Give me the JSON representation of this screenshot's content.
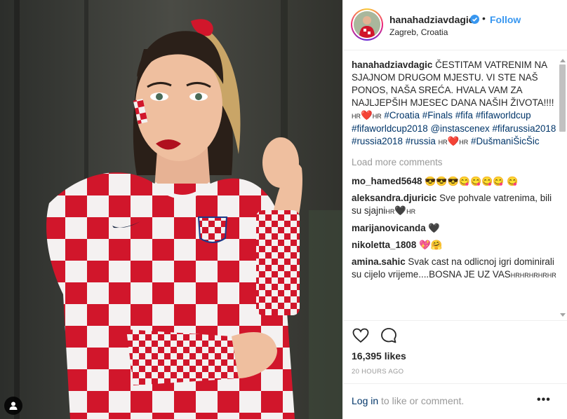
{
  "post": {
    "username": "hanahadziavdagic",
    "location": "Zagreb, Croatia",
    "follow_label": "Follow",
    "dot": "•"
  },
  "caption": {
    "username": "hanahadziavdagic",
    "text": "ČESTITAM VATRENIM NA SJAJNOM DRUGOM MJESTU. VI STE NAŠ PONOS, NAŠA SREĆA. HVALA VAM ZA NAJLJEPŠIH MJESEC DANA NAŠIH ŽIVOTA!!!! ",
    "flag1": "HR",
    "flag2": "HR",
    "flag3": "HR",
    "flag4": "HR",
    "tags_line1": [
      "#Croatia",
      "#Finals",
      "#fifa"
    ],
    "tags_line2": [
      "#fifaworldcup",
      "#fifaworldcup2018"
    ],
    "mention": "@instascenex",
    "tags_line3": [
      "#fifarussia2018",
      "#russia2018"
    ],
    "tag_russia": "#russia",
    "tag_last": "#DušmaniŠicŠic"
  },
  "load_more": "Load more comments",
  "comments": [
    {
      "user": "mo_hamed5648",
      "text": "😎😎😎😋😋😋😋 😋"
    },
    {
      "user": "aleksandra.djuricic",
      "text": "Sve pohvale vatrenima, bili su sjajni",
      "flag": "HR",
      "flag2": "HR"
    },
    {
      "user": "marijanovicanda",
      "text": "🖤"
    },
    {
      "user": "nikoletta_1808",
      "text": "💖🤗"
    },
    {
      "user": "amina.sahic",
      "text": "Svak cast na odlicnoj igri dominirali su cijelo vrijeme....BOSNA JE UZ VAS",
      "flags": "HRHRHRHRHR"
    }
  ],
  "likes": "16,395 likes",
  "time": "20 HOURS AGO",
  "footer": {
    "login_link": "Log in",
    "login_rest": " to like or comment.",
    "more": "•••"
  },
  "colors": {
    "link_blue": "#3897f0",
    "hashtag": "#003569",
    "muted": "#999999",
    "jersey_red": "#d1162b"
  },
  "icons": [
    "verified-badge-icon",
    "heart-icon",
    "comment-bubble-icon",
    "person-tag-icon",
    "more-options-icon"
  ]
}
